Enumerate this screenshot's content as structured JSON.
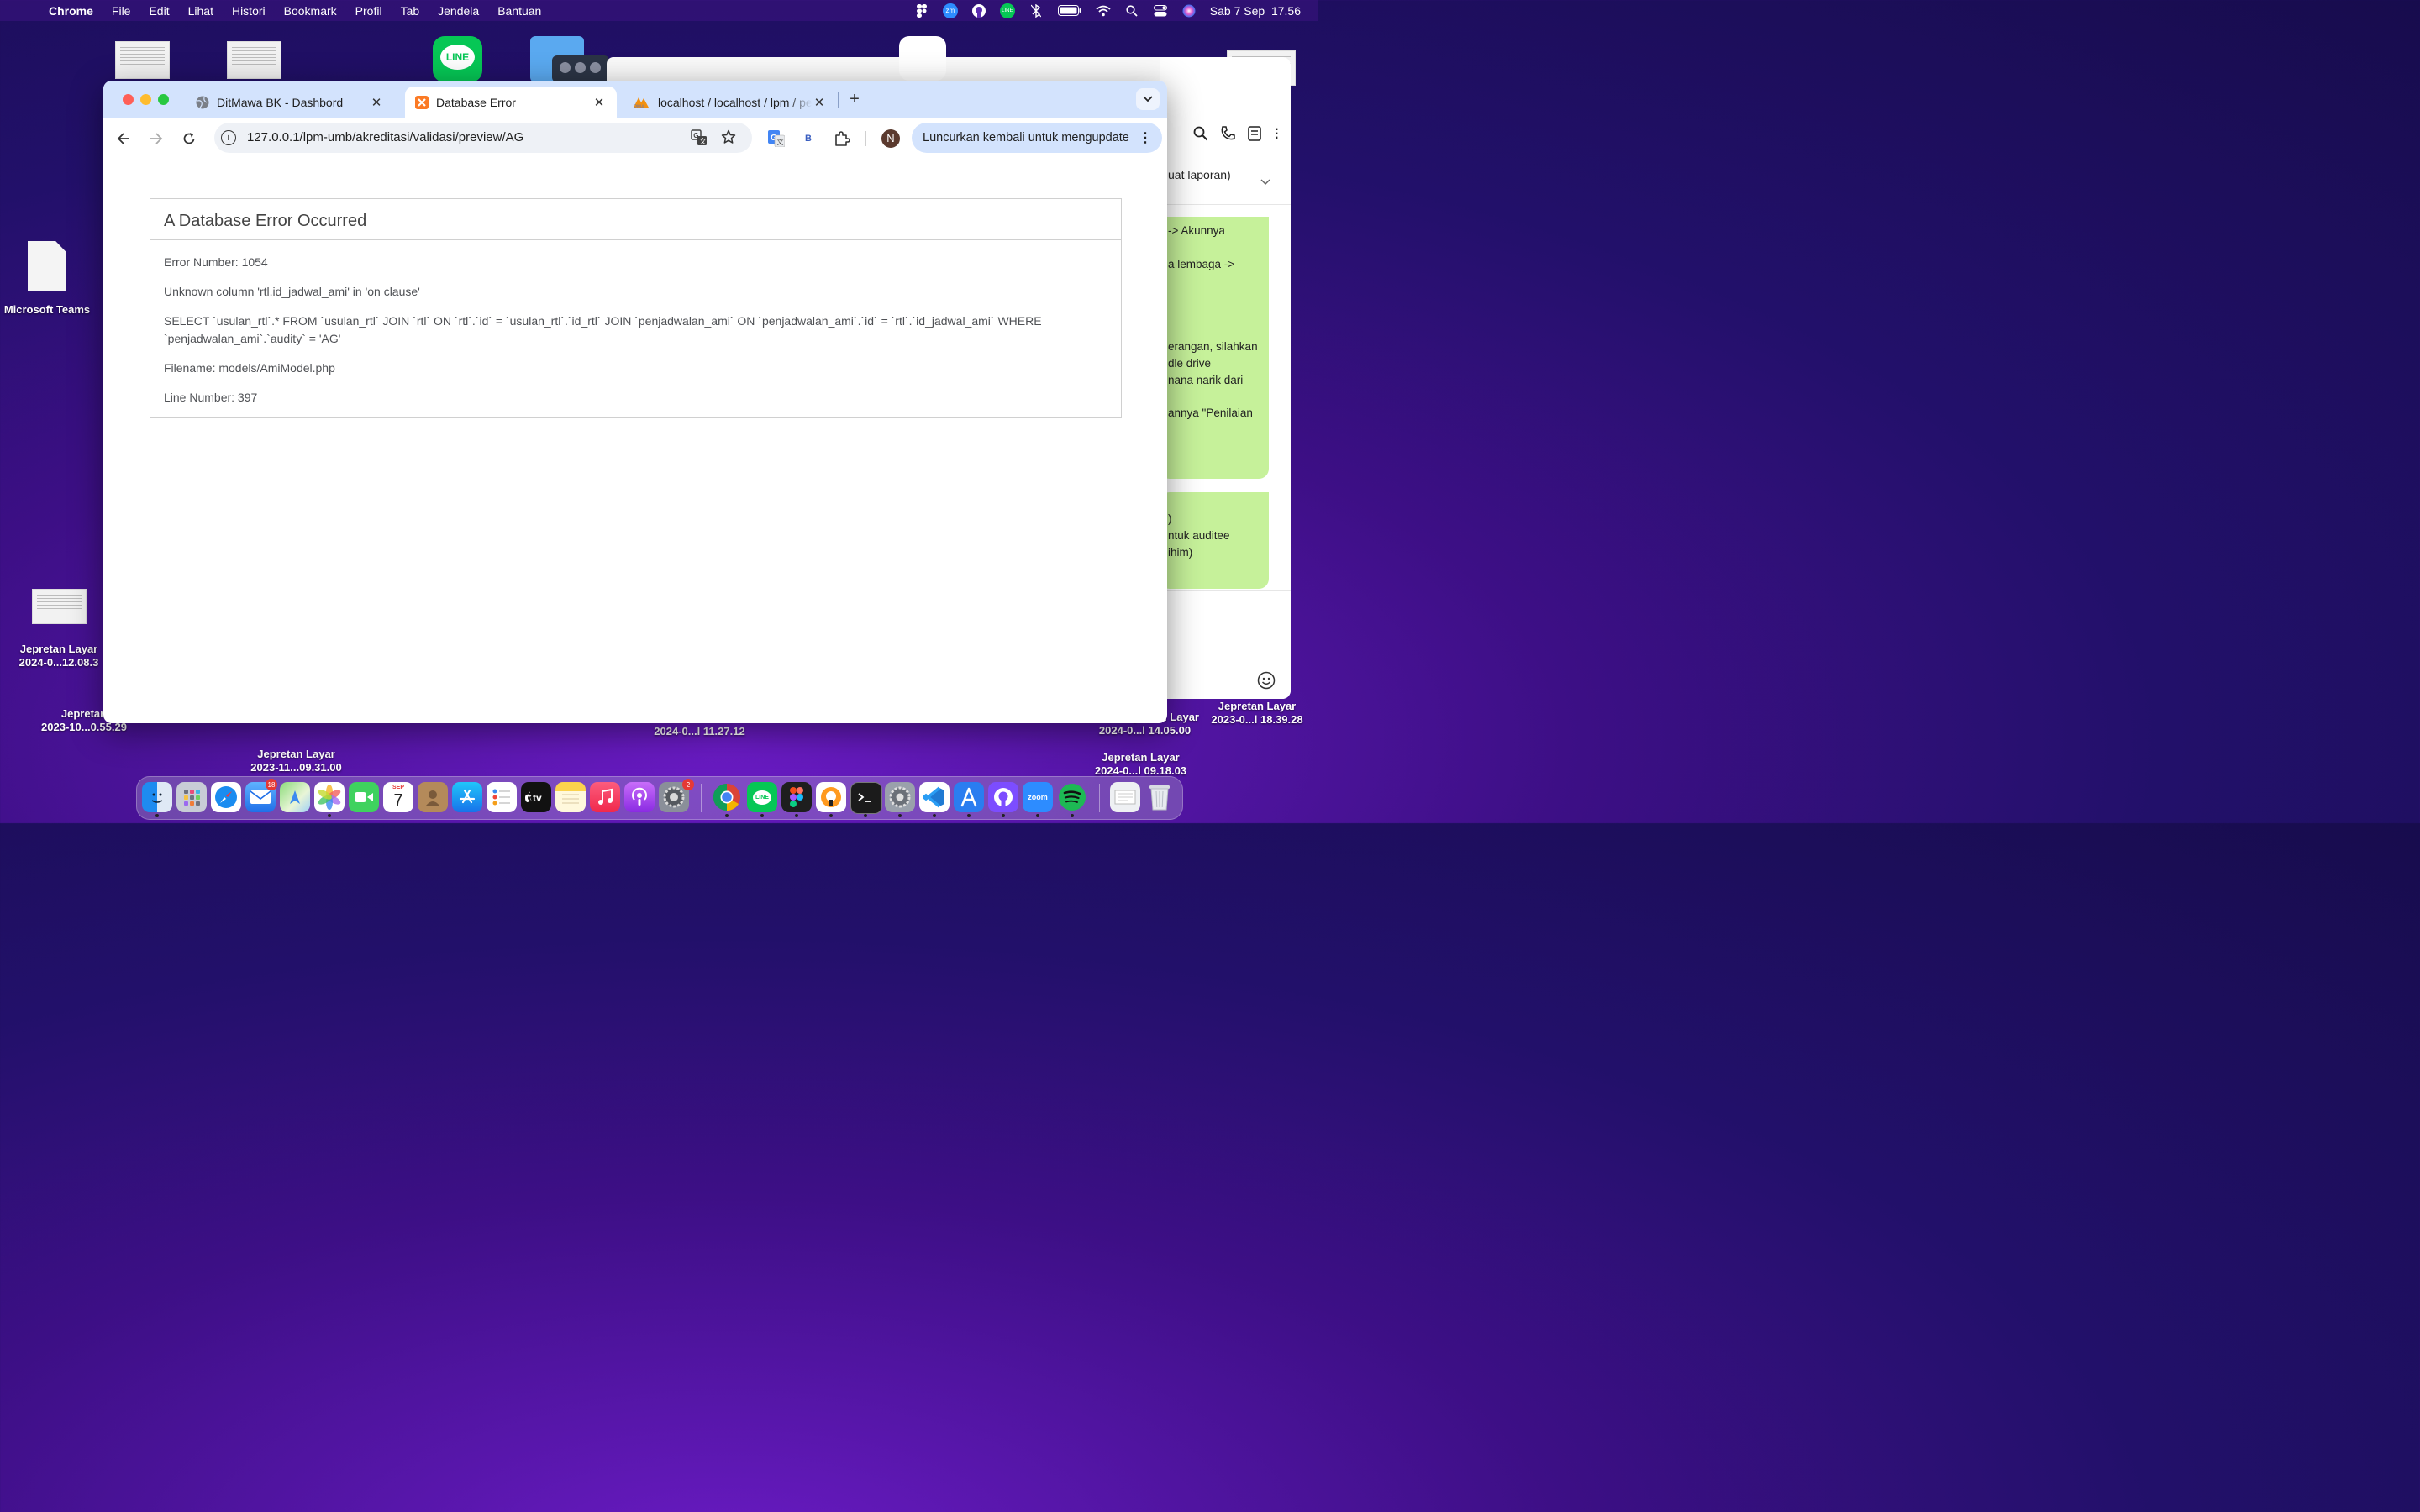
{
  "menubar": {
    "app": "Chrome",
    "menus": [
      "File",
      "Edit",
      "Lihat",
      "Histori",
      "Bookmark",
      "Profil",
      "Tab",
      "Jendela",
      "Bantuan"
    ],
    "datetime": "Sab 7 Sep  17.56"
  },
  "desktop": {
    "teams_label": "Microsoft Teams",
    "screenshots": [
      {
        "l1": "Jepretan Layar",
        "l2": "2024-0...12.08.3"
      },
      {
        "l1": "Jepretan",
        "l2": "2023-10...0.55.29"
      },
      {
        "l1": "Jepretan Layar",
        "l2": "2023-11...09.31.00"
      },
      {
        "l1": "",
        "l2": "2024-0...l 11.27.12"
      },
      {
        "l1": "Jepretan Layar",
        "l2": "2024-0...l 14.05.00"
      },
      {
        "l1": "Jepretan Layar",
        "l2": "2023-0...l 18.39.28"
      },
      {
        "l1": "Jepretan Layar",
        "l2": "2024-0...l 09.18.03"
      }
    ],
    "line_label": "LINE"
  },
  "chat": {
    "subtitle": "uat laporan)",
    "bubble1": [
      "-> Akunnya",
      "",
      "a lembaga ->",
      "",
      "",
      "",
      "",
      "erangan, silahkan",
      "dle drive",
      "nana narik dari",
      "",
      "",
      "annya \"Penilaian"
    ],
    "bubble2": [
      ")",
      "ntuk auditee",
      "ihim)"
    ]
  },
  "browser": {
    "tabs": [
      {
        "title": "DitMawa BK - Dashbord",
        "active": false
      },
      {
        "title": "Database Error",
        "active": true
      },
      {
        "title": "localhost / localhost / lpm / pe",
        "active": false
      }
    ],
    "url": "127.0.0.1/lpm-umb/akreditasi/validasi/preview/AG",
    "profile_initial": "N",
    "update_label": "Luncurkan kembali untuk mengupdate"
  },
  "error": {
    "heading": "A Database Error Occurred",
    "number": "Error Number: 1054",
    "message": "Unknown column 'rtl.id_jadwal_ami' in 'on clause'",
    "query": "SELECT `usulan_rtl`.* FROM `usulan_rtl` JOIN `rtl` ON `rtl`.`id` = `usulan_rtl`.`id_rtl` JOIN `penjadwalan_ami` ON `penjadwalan_ami`.`id` = `rtl`.`id_jadwal_ami` WHERE `penjadwalan_ami`.`audity` = 'AG'",
    "filename": "Filename: models/AmiModel.php",
    "line": "Line Number: 397"
  },
  "dock": {
    "mail_badge": "18",
    "calendar_month": "SEP",
    "calendar_day": "7",
    "settings_badge": "2"
  }
}
